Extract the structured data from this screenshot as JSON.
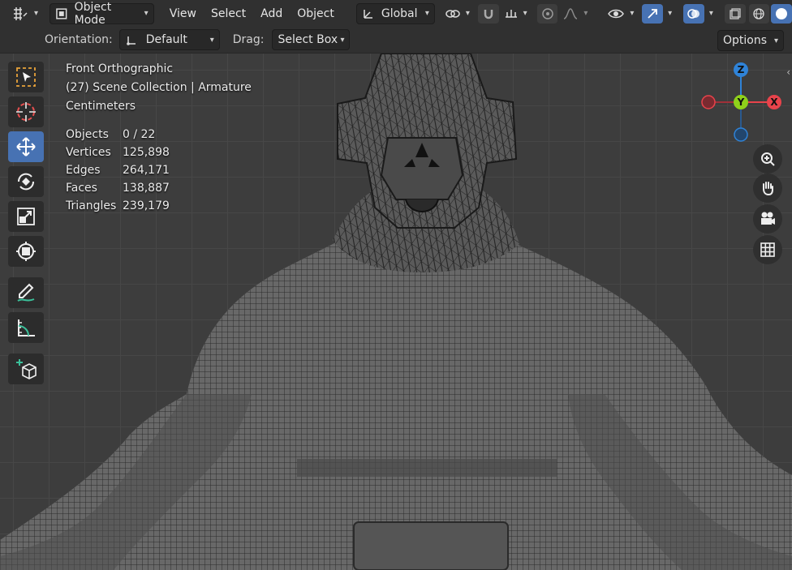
{
  "header": {
    "editor_type_icon": "grid-transform-icon",
    "mode": "Object Mode",
    "menus": [
      "View",
      "Select",
      "Add",
      "Object"
    ],
    "transform_orientation": "Global"
  },
  "tool_header": {
    "orientation_label": "Orientation:",
    "orientation_value": "Default",
    "drag_label": "Drag:",
    "drag_value": "Select Box",
    "options_label": "Options"
  },
  "overlay": {
    "view_name": "Front Orthographic",
    "collection": "(27) Scene Collection | Armature",
    "units": "Centimeters",
    "stats": [
      {
        "label": "Objects",
        "value": "0 / 22"
      },
      {
        "label": "Vertices",
        "value": "125,898"
      },
      {
        "label": "Edges",
        "value": "264,171"
      },
      {
        "label": "Faces",
        "value": "138,887"
      },
      {
        "label": "Triangles",
        "value": "239,179"
      }
    ]
  },
  "gizmo": {
    "z": "Z",
    "y": "Y",
    "x": "X"
  },
  "toolbar": [
    "select-box-icon",
    "cursor-icon",
    "move-icon",
    "rotate-icon",
    "scale-icon",
    "transform-icon",
    "annotate-icon",
    "measure-icon",
    "add-cube-icon"
  ],
  "colors": {
    "accent": "#4772b3",
    "axis_x": "#e8434b",
    "axis_y": "#8fd11a",
    "axis_z": "#2f83d8"
  }
}
